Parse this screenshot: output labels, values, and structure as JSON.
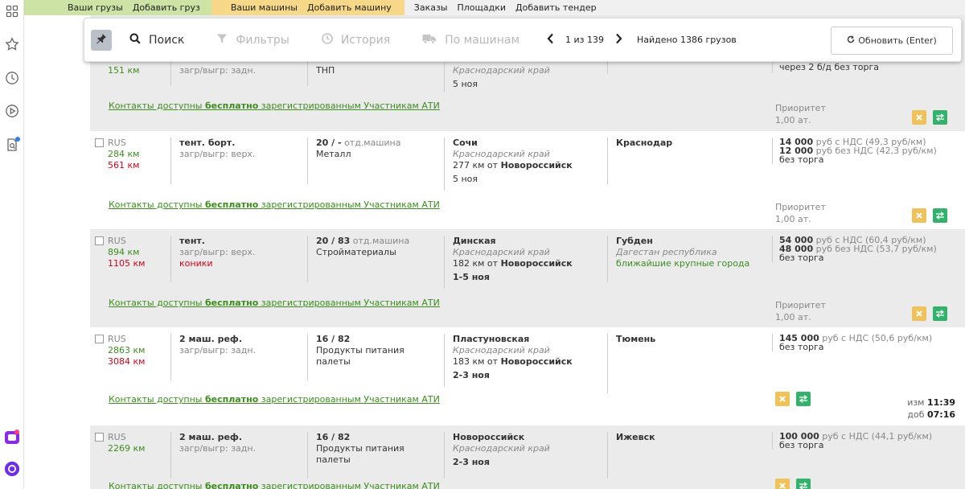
{
  "colors": {
    "accent_green": "#3c8d1e",
    "distance_red": "#d0021b",
    "nav_green": "#cde3a6",
    "nav_yellow": "#f6d888",
    "btn_yellow": "#f0c25a",
    "btn_green": "#34b16a"
  },
  "nav": {
    "green": [
      "Ваши грузы",
      "Добавить груз"
    ],
    "yellow": [
      "Ваши машины",
      "Добавить машину"
    ],
    "plain": [
      "Заказы",
      "Площадки",
      "Добавить тендер"
    ]
  },
  "toolbar": {
    "search": "Поиск",
    "filters": "Фильтры",
    "history": "История",
    "by_trucks": "По машинам",
    "page_info": "1 из 139",
    "found": "Найдено 1386 грузов",
    "refresh": "Обновить (Enter)"
  },
  "contacts": {
    "pre": "Контакты доступны ",
    "bold": "бесплатно",
    "post": " зарегистрированным Участникам АТИ"
  },
  "priority_label": "Приоритет",
  "row0": {
    "dist": "151 км",
    "load": "загр/выгр: задн.",
    "cargo": "ТНП",
    "from_region": "Краснодарский край",
    "date": "5 ноя",
    "price": "через 2 б/д без торга",
    "priority": "1,00 ат."
  },
  "rows": [
    {
      "country": "RUS",
      "dist1": "284 км",
      "dist2": "561 км",
      "body": "тент. борт.",
      "load": "загр/выгр: верх.",
      "load_extra": "",
      "weight": "20 / -",
      "weight_note": "отд.машина",
      "cargo": "Металл",
      "cargo2": "",
      "from": "Сочи",
      "from_region": "Краснодарский край",
      "from_dist": "277 км от",
      "from_dist_city": "Новороссийск",
      "date": "5 ноя",
      "to": "Краснодар",
      "to_region": "",
      "to_link": "",
      "price1": "14 000",
      "price1_unit": "руб с НДС",
      "price1_rate": "(49,3 руб/км)",
      "price2": "12 000",
      "price2_unit": "руб без НДС",
      "price2_rate": "(42,3 руб/км)",
      "terms": "без торга",
      "priority": "1,00 ат."
    },
    {
      "country": "RUS",
      "dist1": "894 км",
      "dist2": "1105 км",
      "body": "тент.",
      "load": "загр/выгр: верх.",
      "load_extra": "коники",
      "weight": "20 / 83",
      "weight_note": "отд.машина",
      "cargo": "Стройматериалы",
      "cargo2": "",
      "from": "Динская",
      "from_region": "Краснодарский край",
      "from_dist": "182 км от",
      "from_dist_city": "Новороссийск",
      "date": "1-5 ноя",
      "to": "Губден",
      "to_region": "Дагестан республика",
      "to_link": "ближайшие крупные города",
      "price1": "54 000",
      "price1_unit": "руб с НДС",
      "price1_rate": "(60,4 руб/км)",
      "price2": "48 000",
      "price2_unit": "руб без НДС",
      "price2_rate": "(53,7 руб/км)",
      "terms": "без торга",
      "priority": "1,00 ат."
    },
    {
      "country": "RUS",
      "dist1": "2863 км",
      "dist2": "3084 км",
      "body": "2 маш. реф.",
      "load": "загр/выгр: задн.",
      "load_extra": "",
      "weight": "16 / 82",
      "weight_note": "",
      "cargo": "Продукты питания",
      "cargo2": "палеты",
      "from": "Пластуновская",
      "from_region": "Краснодарский край",
      "from_dist": "183 км от",
      "from_dist_city": "Новороссийск",
      "date": "2-3 ноя",
      "to": "Тюмень",
      "to_region": "",
      "to_link": "",
      "price1": "145 000",
      "price1_unit": "руб с НДС",
      "price1_rate": "(50,6 руб/км)",
      "price2": "",
      "price2_unit": "",
      "price2_rate": "",
      "terms": "без торга",
      "priority": "",
      "changed_label": "изм",
      "changed_time": "11:39",
      "added_label": "доб",
      "added_time": "07:16"
    },
    {
      "country": "RUS",
      "dist1": "2269 км",
      "dist2": "",
      "body": "2 маш. реф.",
      "load": "загр/выгр: задн.",
      "load_extra": "",
      "weight": "16 / 82",
      "weight_note": "",
      "cargo": "Продукты питания",
      "cargo2": "палеты",
      "from": "Новороссийск",
      "from_region": "Краснодарский край",
      "from_dist": "",
      "from_dist_city": "",
      "date": "2-3 ноя",
      "to": "Ижевск",
      "to_region": "",
      "to_link": "",
      "price1": "100 000",
      "price1_unit": "руб с НДС",
      "price1_rate": "(44,1 руб/км)",
      "price2": "",
      "price2_unit": "",
      "price2_rate": "",
      "terms": "без торга",
      "priority": ""
    }
  ]
}
